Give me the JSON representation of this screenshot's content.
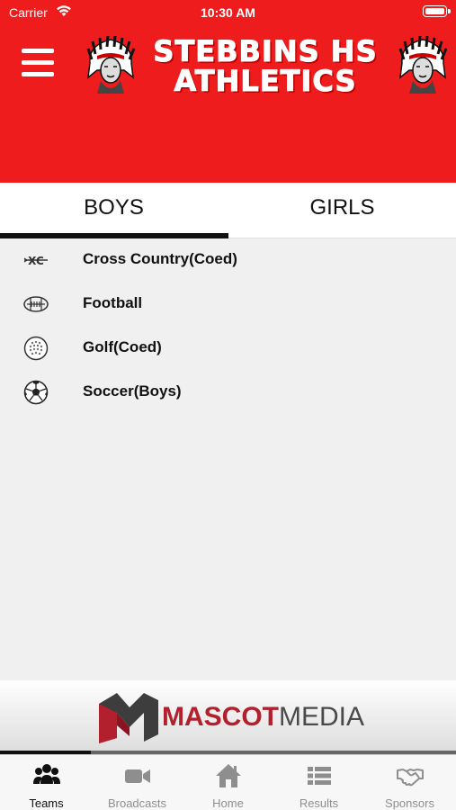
{
  "status_bar": {
    "carrier": "Carrier",
    "time": "10:30 AM"
  },
  "header": {
    "title_line1": "STEBBINS HS",
    "title_line2": "ATHLETICS",
    "background": "#ee1c1c"
  },
  "tabs": [
    {
      "label": "BOYS",
      "selected": true
    },
    {
      "label": "GIRLS",
      "selected": false
    }
  ],
  "sports": [
    {
      "label": "Cross Country(Coed)",
      "icon": "cross-country-icon",
      "icon_text": "XC"
    },
    {
      "label": "Football",
      "icon": "football-icon"
    },
    {
      "label": "Golf(Coed)",
      "icon": "golf-ball-icon"
    },
    {
      "label": "Soccer(Boys)",
      "icon": "soccer-ball-icon"
    }
  ],
  "sponsor": {
    "name_part1": "MASCOT",
    "name_part2": "MEDIA",
    "accent": "#b3202d"
  },
  "carousel_progress": 0.2,
  "bottom_nav": [
    {
      "label": "Teams",
      "icon": "teams-icon",
      "active": true
    },
    {
      "label": "Broadcasts",
      "icon": "video-camera-icon",
      "active": false
    },
    {
      "label": "Home",
      "icon": "home-icon",
      "active": false
    },
    {
      "label": "Results",
      "icon": "list-icon",
      "active": false
    },
    {
      "label": "Sponsors",
      "icon": "handshake-icon",
      "active": false
    }
  ]
}
